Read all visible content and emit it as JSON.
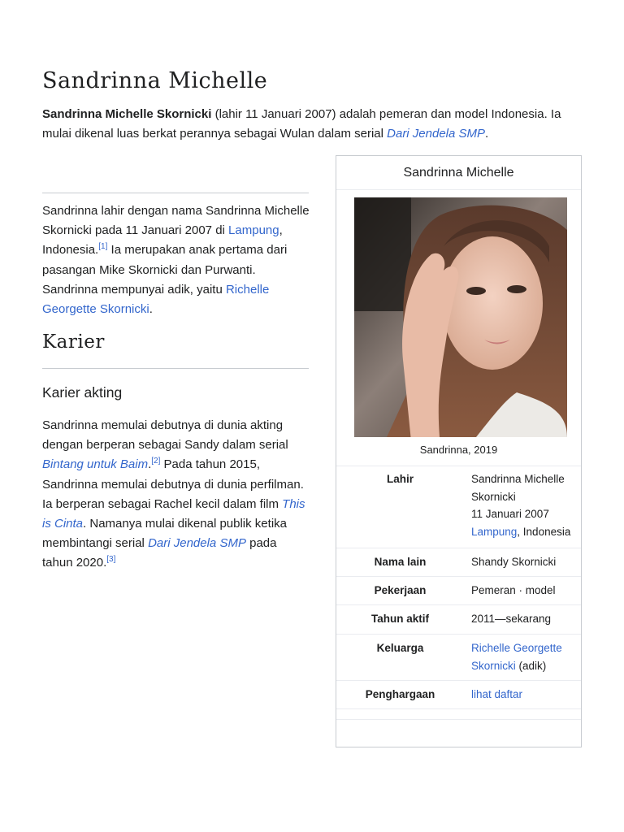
{
  "title": "Sandrinna Michelle",
  "lead": {
    "bold_name": "Sandrinna Michelle Skornicki",
    "text_1": " (lahir 11 Januari 2007) adalah pemeran dan model Indonesia. Ia mulai dikenal luas berkat perannya sebagai Wulan dalam serial ",
    "link_series": "Dari Jendela SMP",
    "text_2": "."
  },
  "bio": {
    "t1": "Sandrinna lahir dengan nama Sandrinna Michelle Skornicki pada 11 Januari 2007 di ",
    "link_lampung": "Lampung",
    "t2": ", Indonesia.",
    "ref1": "[1]",
    "t3": " Ia merupakan anak pertama dari pasangan Mike Skornicki dan Purwanti. Sandrinna mempunyai adik, yaitu ",
    "link_sister": "Richelle Georgette Skornicki",
    "t4": "."
  },
  "career": {
    "heading": "Karier",
    "subheading": "Karier akting",
    "t1": "Sandrinna memulai debutnya di dunia akting dengan berperan sebagai Sandy dalam serial ",
    "link_baim": "Bintang untuk Baim",
    "t2": ".",
    "ref2": "[2]",
    "t3": " Pada tahun 2015, Sandrinna memulai debutnya di dunia perfilman. Ia berperan sebagai Rachel kecil dalam film ",
    "link_film": "This is Cinta",
    "t4": ". Namanya mulai dikenal publik ketika membintangi serial ",
    "link_series": "Dari Jendela SMP",
    "t5": " pada tahun 2020.",
    "ref3": "[3]"
  },
  "infobox": {
    "title": "Sandrinna Michelle",
    "caption": "Sandrinna, 2019",
    "born_label": "Lahir",
    "born_name": "Sandrinna Michelle Skornicki",
    "born_date": "11 Januari 2007",
    "born_place_link": "Lampung",
    "born_place_rest": ", Indonesia",
    "alias_label": "Nama lain",
    "alias_value": "Shandy Skornicki",
    "job_label": "Pekerjaan",
    "job_value": "Pemeran · model",
    "active_label": "Tahun aktif",
    "active_value": "2011—sekarang",
    "family_label": "Keluarga",
    "family_link": "Richelle Georgette Skornicki",
    "family_rest": " (adik)",
    "awards_label": "Penghargaan",
    "awards_link": "lihat daftar"
  },
  "colors": {
    "link": "#3366cc",
    "text": "#202122",
    "border": "#c8ccd1"
  }
}
